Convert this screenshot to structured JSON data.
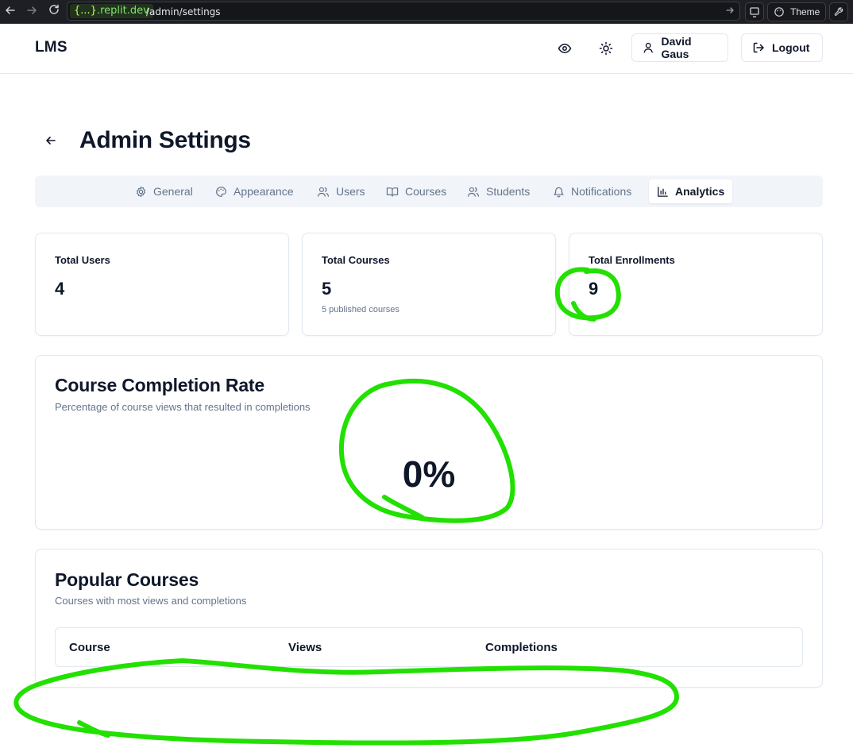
{
  "browser": {
    "domain_prefix": "{...}",
    "domain_suffix": ".replit.dev",
    "path": "/admin/settings",
    "theme_label": "Theme"
  },
  "header": {
    "brand": "LMS",
    "user_name": "David Gaus",
    "logout_label": "Logout"
  },
  "page": {
    "title": "Admin Settings"
  },
  "tabs": [
    {
      "label": "General",
      "icon": "gear-icon",
      "active": false
    },
    {
      "label": "Appearance",
      "icon": "palette-icon",
      "active": false
    },
    {
      "label": "Users",
      "icon": "users-icon",
      "active": false
    },
    {
      "label": "Courses",
      "icon": "book-open-icon",
      "active": false
    },
    {
      "label": "Students",
      "icon": "users-icon",
      "active": false
    },
    {
      "label": "Notifications",
      "icon": "bell-icon",
      "active": false
    },
    {
      "label": "Analytics",
      "icon": "bar-chart-icon",
      "active": true
    }
  ],
  "stats": [
    {
      "label": "Total Users",
      "value": "4",
      "sub": ""
    },
    {
      "label": "Total Courses",
      "value": "5",
      "sub": "5 published courses"
    },
    {
      "label": "Total Enrollments",
      "value": "9",
      "sub": ""
    }
  ],
  "completion": {
    "title": "Course Completion Rate",
    "subtitle": "Percentage of course views that resulted in completions",
    "value": "0%"
  },
  "popular": {
    "title": "Popular Courses",
    "subtitle": "Courses with most views and completions",
    "columns": [
      "Course",
      "Views",
      "Completions"
    ]
  },
  "colors": {
    "annotation": "#22e000",
    "muted_text": "#64748b",
    "border": "#e2e8f0",
    "tab_bg": "#f1f5f9"
  }
}
